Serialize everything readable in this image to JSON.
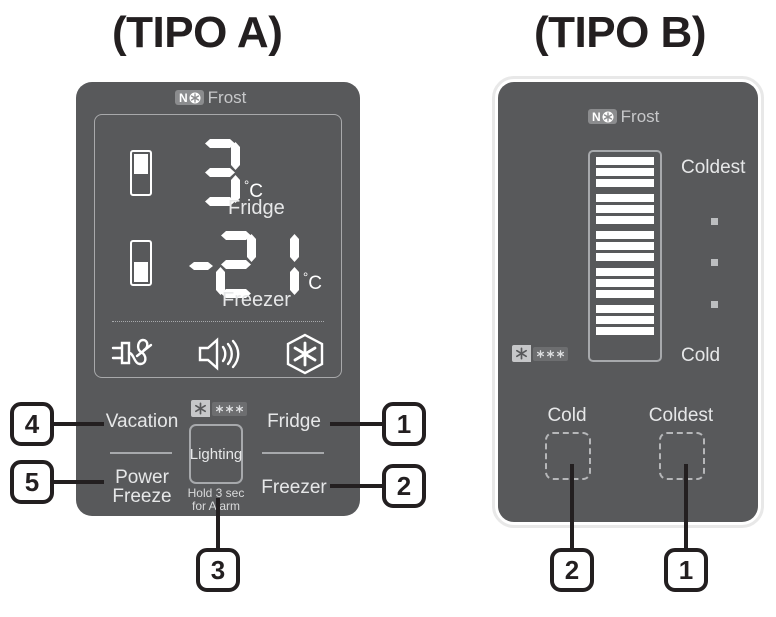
{
  "titles": {
    "type_a": "(TIPO A)",
    "type_b": "(TIPO B)"
  },
  "brand": {
    "logo_n": "N",
    "logo_word": "Frost",
    "flake_icon": "snowflake-icon"
  },
  "type_a": {
    "display": {
      "fridge": {
        "compartment_icon": "fridge-compartment-icon",
        "value": "3",
        "unit": "C",
        "degree": "°",
        "label": "Fridge"
      },
      "freezer": {
        "compartment_icon": "freezer-compartment-icon",
        "sign": "-",
        "value": "21",
        "unit": "C",
        "degree": "°",
        "label": "Freezer"
      },
      "status_icons": [
        {
          "name": "power-plug-unplugged-icon",
          "meaning": "vacation"
        },
        {
          "name": "speaker-alarm-icon",
          "meaning": "alarm"
        },
        {
          "name": "snowflake-hexagon-icon",
          "meaning": "power-freeze"
        }
      ]
    },
    "controls": {
      "vacation": "Vacation",
      "power_freeze": "Power\nFreeze",
      "fridge": "Fridge",
      "freezer": "Freezer",
      "lighting": "Lighting",
      "lighting_hint": "Hold 3 sec\nfor Alarm",
      "star_badge": {
        "one_star": "star-icon",
        "three_star": "three-star-icon"
      }
    },
    "callouts": [
      {
        "number": "1",
        "target": "Fridge"
      },
      {
        "number": "2",
        "target": "Freezer"
      },
      {
        "number": "3",
        "target": "Lighting"
      },
      {
        "number": "4",
        "target": "Vacation"
      },
      {
        "number": "5",
        "target": "Power Freeze"
      }
    ]
  },
  "type_b": {
    "bargraph": {
      "segments": 15,
      "groups": 5,
      "icon": "temperature-bargraph-icon"
    },
    "scale": {
      "top_label": "Coldest",
      "bottom_label": "Cold",
      "dots": 3
    },
    "star_badge": {
      "one_star": "star-icon",
      "three_star": "three-star-icon"
    },
    "buttons": {
      "cold": "Cold",
      "coldest": "Coldest"
    },
    "callouts": [
      {
        "number": "1",
        "target": "Coldest"
      },
      {
        "number": "2",
        "target": "Cold"
      }
    ]
  },
  "colors": {
    "panel": "#58595b",
    "panel_light_frame": "#e8e8e8",
    "text_light": "#e6e7e8",
    "segment": "#ffffff",
    "outline": "#231f20",
    "dot": "#bcbec0"
  }
}
